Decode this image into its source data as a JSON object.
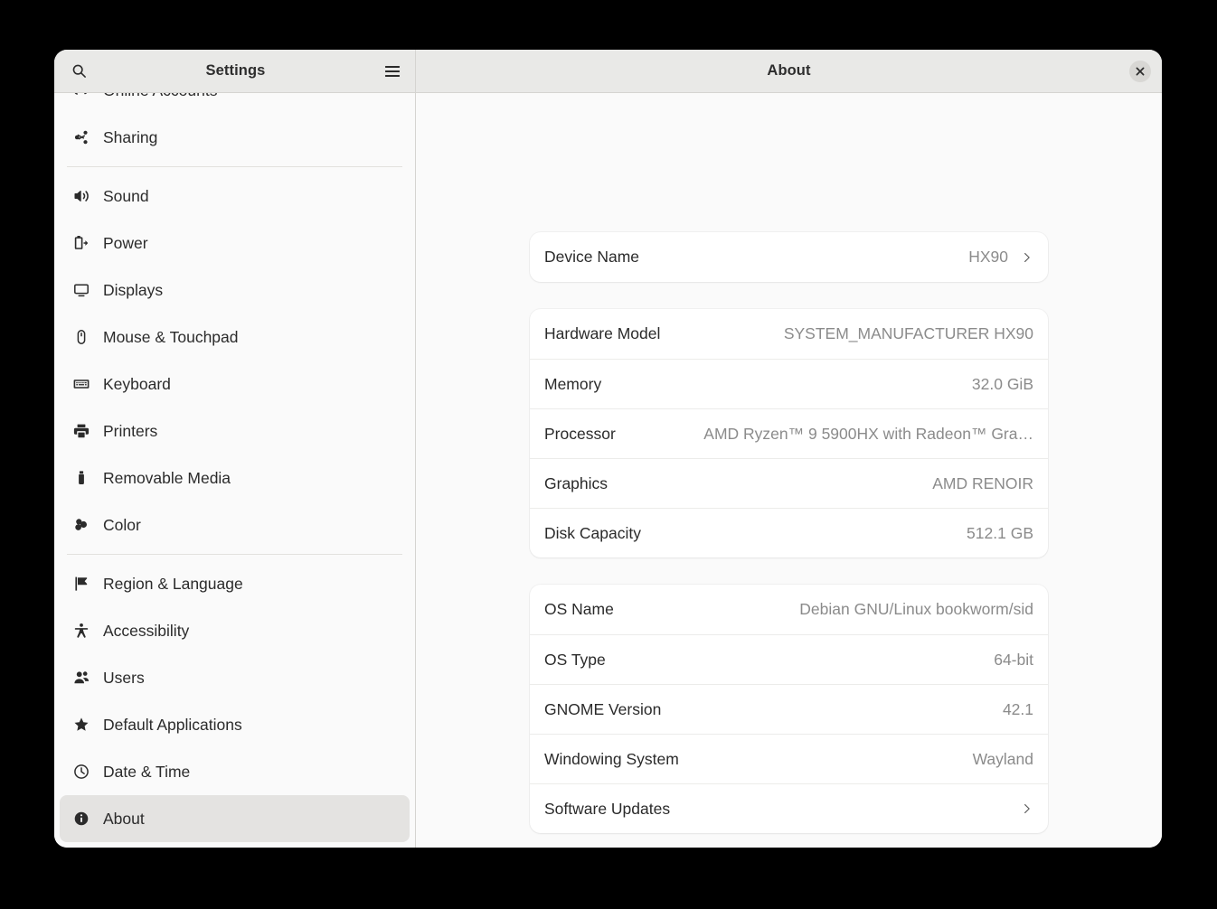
{
  "window": {
    "close_label": "✕"
  },
  "sidebar_header": {
    "title": "Settings",
    "search_icon": "search-icon",
    "menu_icon": "hamburger-menu-icon"
  },
  "content_header": {
    "title": "About"
  },
  "sidebar": {
    "groups": [
      {
        "items": [
          {
            "label": "Online Accounts",
            "icon": "cloud-accounts-icon",
            "selected": false
          },
          {
            "label": "Sharing",
            "icon": "share-icon",
            "selected": false
          }
        ]
      },
      {
        "items": [
          {
            "label": "Sound",
            "icon": "speaker-icon",
            "selected": false
          },
          {
            "label": "Power",
            "icon": "battery-icon",
            "selected": false
          },
          {
            "label": "Displays",
            "icon": "monitor-icon",
            "selected": false
          },
          {
            "label": "Mouse & Touchpad",
            "icon": "mouse-icon",
            "selected": false
          },
          {
            "label": "Keyboard",
            "icon": "keyboard-icon",
            "selected": false
          },
          {
            "label": "Printers",
            "icon": "printer-icon",
            "selected": false
          },
          {
            "label": "Removable Media",
            "icon": "usb-drive-icon",
            "selected": false
          },
          {
            "label": "Color",
            "icon": "color-circles-icon",
            "selected": false
          }
        ]
      },
      {
        "items": [
          {
            "label": "Region & Language",
            "icon": "flag-icon",
            "selected": false
          },
          {
            "label": "Accessibility",
            "icon": "accessibility-person-icon",
            "selected": false
          },
          {
            "label": "Users",
            "icon": "users-icon",
            "selected": false
          },
          {
            "label": "Default Applications",
            "icon": "star-icon",
            "selected": false
          },
          {
            "label": "Date & Time",
            "icon": "clock-icon",
            "selected": false
          },
          {
            "label": "About",
            "icon": "info-circle-icon",
            "selected": true
          }
        ]
      }
    ]
  },
  "about": {
    "cards": [
      {
        "name": "device-name-card",
        "rows": [
          {
            "label": "Device Name",
            "value": "HX90",
            "chevron": true
          }
        ]
      },
      {
        "name": "hardware-card",
        "rows": [
          {
            "label": "Hardware Model",
            "value": "SYSTEM_MANUFACTURER HX90",
            "chevron": false
          },
          {
            "label": "Memory",
            "value": "32.0 GiB",
            "chevron": false
          },
          {
            "label": "Processor",
            "value": "AMD Ryzen™ 9 5900HX with Radeon™ Gra…",
            "chevron": false
          },
          {
            "label": "Graphics",
            "value": "AMD RENOIR",
            "chevron": false
          },
          {
            "label": "Disk Capacity",
            "value": "512.1 GB",
            "chevron": false
          }
        ]
      },
      {
        "name": "software-card",
        "rows": [
          {
            "label": "OS Name",
            "value": "Debian GNU/Linux bookworm/sid",
            "chevron": false
          },
          {
            "label": "OS Type",
            "value": "64-bit",
            "chevron": false
          },
          {
            "label": "GNOME Version",
            "value": "42.1",
            "chevron": false
          },
          {
            "label": "Windowing System",
            "value": "Wayland",
            "chevron": false
          },
          {
            "label": "Software Updates",
            "value": "",
            "chevron": true
          }
        ]
      }
    ]
  },
  "colors": {
    "header_bg": "#e9e9e7",
    "sidebar_bg": "#fafafa",
    "content_bg": "#fafafa",
    "card_bg": "#ffffff",
    "selected_row": "#e4e3e1",
    "text": "#2b2b2b",
    "muted_text": "#8b8b8b"
  }
}
